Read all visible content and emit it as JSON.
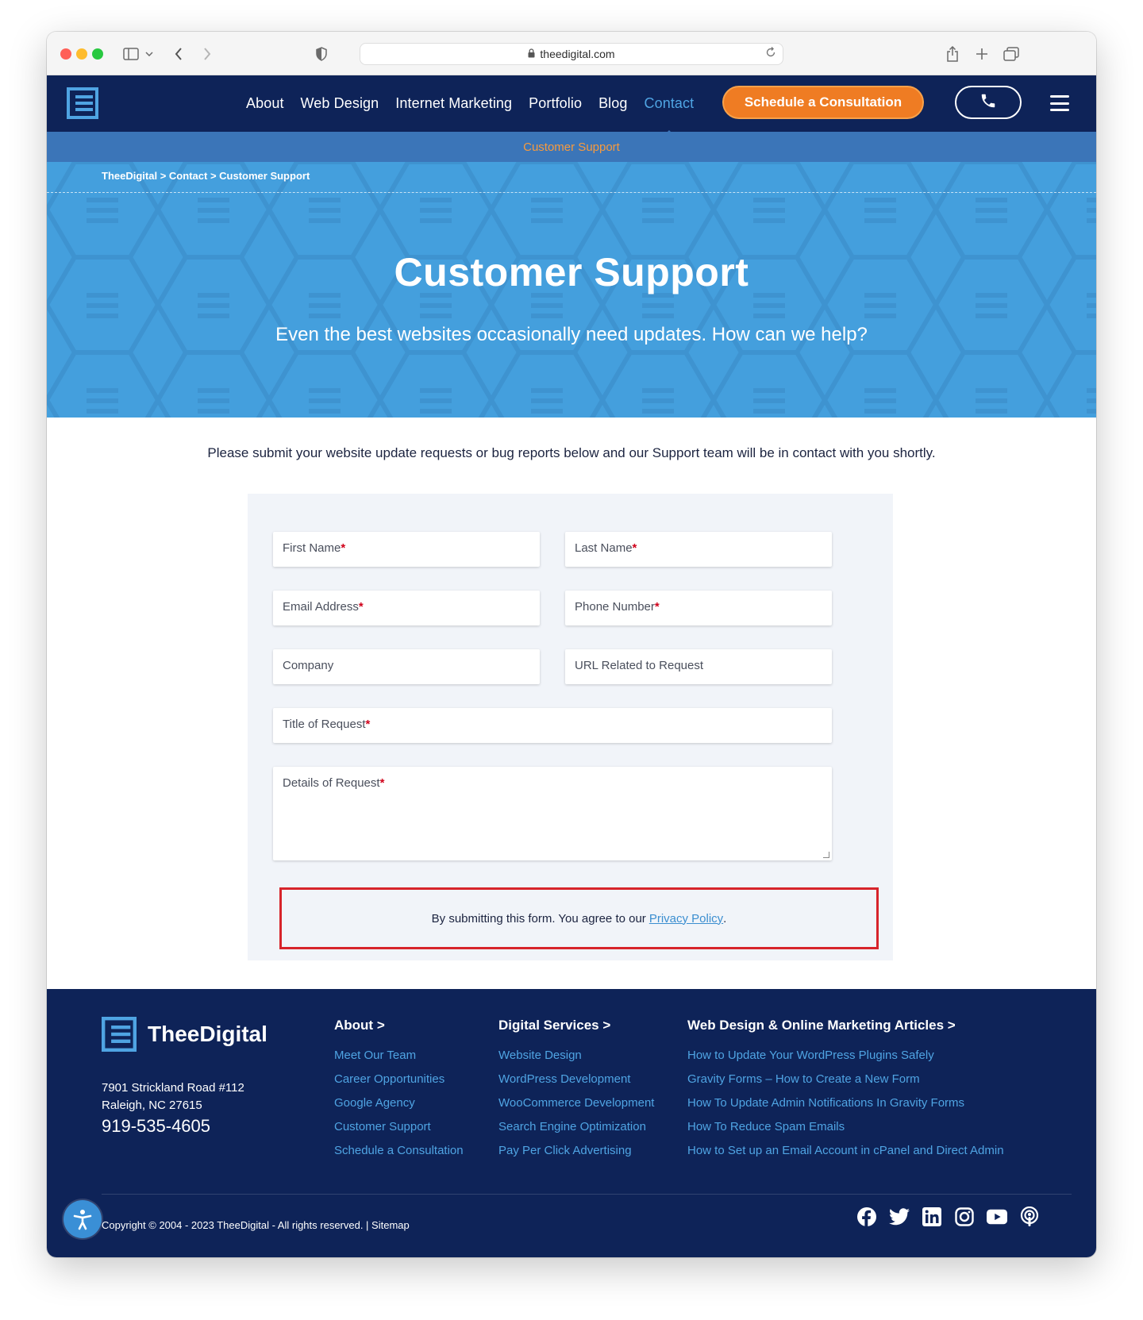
{
  "browser": {
    "url": "theedigital.com",
    "colors": {
      "close": "#ff5f57",
      "minimize": "#febc2e",
      "zoom": "#28c840"
    }
  },
  "nav": {
    "items": [
      "About",
      "Web Design",
      "Internet Marketing",
      "Portfolio",
      "Blog",
      "Contact"
    ],
    "active_item": "Contact",
    "cta_label": "Schedule a Consultation",
    "subnav_label": "Customer Support",
    "colors": {
      "bg": "#0e2358",
      "cta": "#ef7c23",
      "accent": "#4fa4e3"
    }
  },
  "breadcrumb": {
    "items": [
      "TheeDigital",
      "Contact",
      "Customer Support"
    ],
    "separator": ">"
  },
  "hero": {
    "title": "Customer Support",
    "subtitle": "Even the best websites occasionally need updates. How can we help?",
    "bg_color": "#449fdd"
  },
  "intro_text": "Please submit your website update requests or bug reports below and our Support team will be in contact with you shortly.",
  "form": {
    "fields": [
      {
        "placeholder": "First Name",
        "required": true
      },
      {
        "placeholder": "Last Name",
        "required": true
      },
      {
        "placeholder": "Email Address",
        "required": true
      },
      {
        "placeholder": "Phone Number",
        "required": true
      },
      {
        "placeholder": "Company",
        "required": false
      },
      {
        "placeholder": "URL Related to Request",
        "required": false
      },
      {
        "placeholder": "Title of Request",
        "required": true
      },
      {
        "placeholder": "Details of Request",
        "required": true
      }
    ],
    "required_marker": "*",
    "consent_text": "By submitting this form. You agree to our",
    "consent_link": "Privacy Policy",
    "consent_end": "."
  },
  "footer": {
    "brand": "TheeDigital",
    "address_line1": "7901 Strickland Road #112",
    "address_line2": "Raleigh, NC 27615",
    "phone": "919-535-4605",
    "columns": [
      {
        "heading": "About >",
        "links": [
          "Meet Our Team",
          "Career Opportunities",
          "Google Agency",
          "Customer Support",
          "Schedule a Consultation"
        ]
      },
      {
        "heading": "Digital Services >",
        "links": [
          "Website Design",
          "WordPress Development",
          "WooCommerce Development",
          "Search Engine Optimization",
          "Pay Per Click Advertising"
        ]
      },
      {
        "heading": "Web Design & Online Marketing Articles >",
        "links": [
          "How to Update Your WordPress Plugins Safely",
          "Gravity Forms – How to Create a New Form",
          "How To Update Admin Notifications In Gravity Forms",
          "How To Reduce Spam Emails",
          "How to Set up an Email Account in cPanel and Direct Admin"
        ]
      }
    ],
    "copyright": "Copyright © 2004 - 2023 TheeDigital - All rights reserved. | Sitemap",
    "social_icons": [
      "facebook-icon",
      "twitter-icon",
      "linkedin-icon",
      "instagram-icon",
      "youtube-icon",
      "podcast-icon"
    ]
  }
}
